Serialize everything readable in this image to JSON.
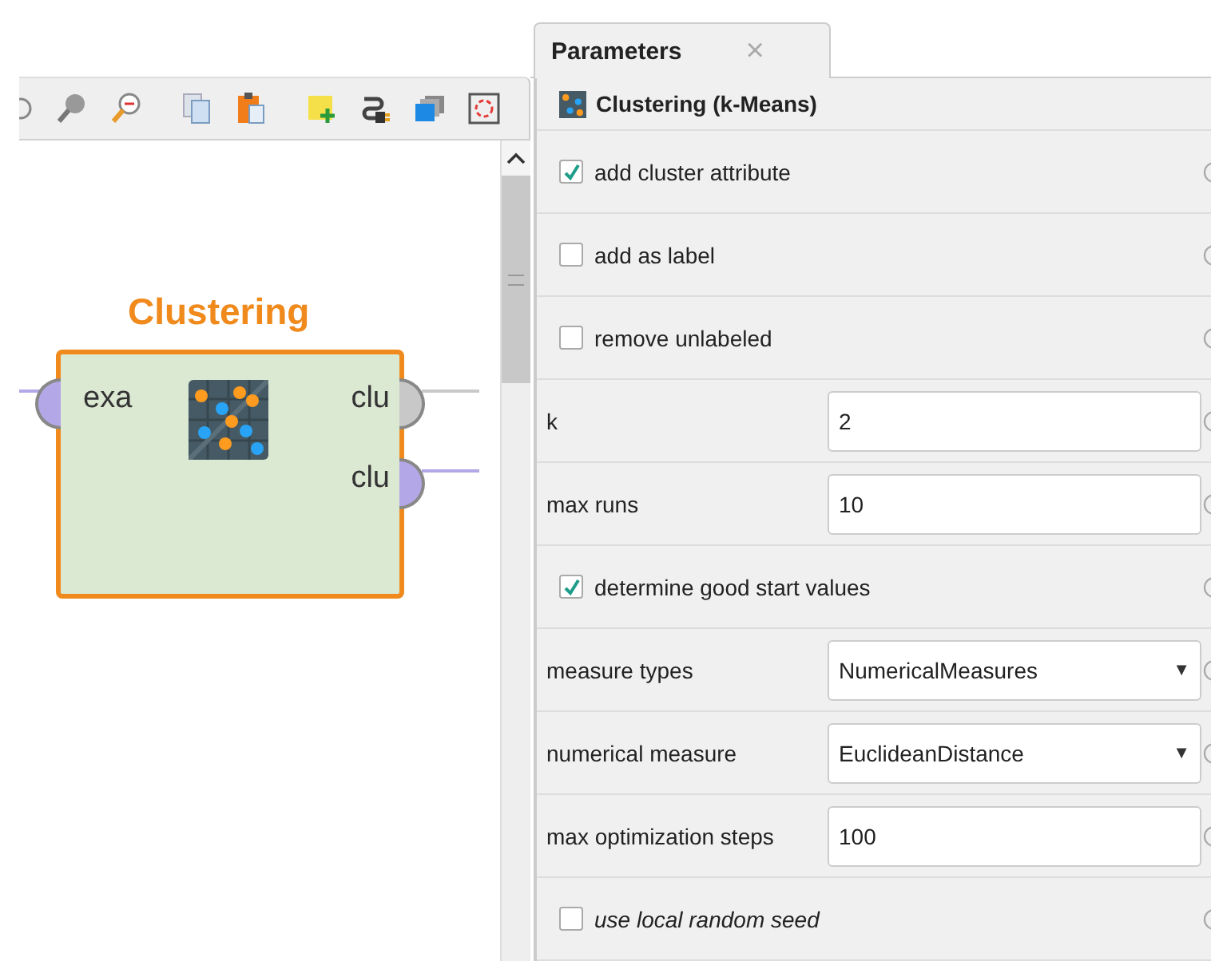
{
  "process": {
    "operator": {
      "name": "Clustering",
      "selected": true,
      "inputs": [
        {
          "label": "exa",
          "color": "#b4a7e8",
          "connected": true
        }
      ],
      "outputs": [
        {
          "label": "clu",
          "color": "#c8c8c8",
          "connected": true
        },
        {
          "label": "clu",
          "color": "#b4a7e8",
          "connected": true
        }
      ]
    }
  },
  "parameters": {
    "tab": {
      "label": "Parameters",
      "close": "×",
      "selected": true
    },
    "operator_title": "Clustering (k-Means)",
    "rows": [
      {
        "kind": "checkbox",
        "label": "add cluster attribute",
        "checked": true,
        "expert": false
      },
      {
        "kind": "checkbox",
        "label": "add as label",
        "checked": false,
        "expert": false
      },
      {
        "kind": "checkbox",
        "label": "remove unlabeled",
        "checked": false,
        "expert": false
      },
      {
        "kind": "text",
        "label": "k",
        "value": "2"
      },
      {
        "kind": "text",
        "label": "max runs",
        "value": "10"
      },
      {
        "kind": "checkbox",
        "label": "determine good start values",
        "checked": true,
        "expert": false
      },
      {
        "kind": "select",
        "label": "measure types",
        "value": "NumericalMeasures",
        "arrow": "▼"
      },
      {
        "kind": "select",
        "label": "numerical measure",
        "value": "EuclideanDistance",
        "arrow": "▼"
      },
      {
        "kind": "text",
        "label": "max optimization steps",
        "value": "100"
      },
      {
        "kind": "checkbox",
        "label": "use local random seed",
        "checked": false,
        "expert": true
      }
    ]
  }
}
